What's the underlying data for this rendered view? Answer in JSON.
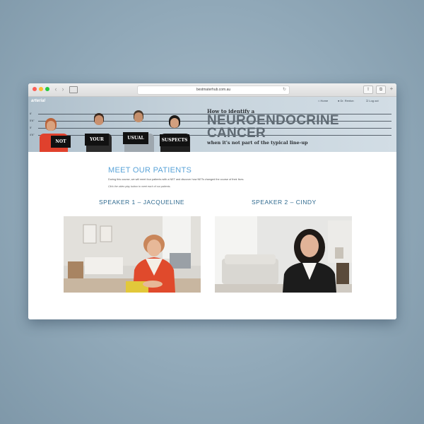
{
  "browser": {
    "url": "bestmaterhub.com.au"
  },
  "site": {
    "logo": "arterial",
    "nav": {
      "home": "Home",
      "user": "Dr. Renton",
      "logout": "Log out"
    }
  },
  "banner": {
    "height_marks": [
      "6'",
      "5'6\"",
      "5'",
      "4'6\""
    ],
    "signs": [
      "NOT",
      "YOUR",
      "USUAL",
      "SUSPECTS"
    ],
    "title_top": "How to identify a",
    "title_line1": "NEUROENDOCRINE",
    "title_line2": "CANCER",
    "title_sub": "when it's not part of the typical line-up"
  },
  "content": {
    "heading": "MEET OUR PATIENTS",
    "intro": "During this course, we will meet four patients with a NET and discover how NETs changed the course of their lives.",
    "note": "Click the video play button to meet each of our patients.",
    "speakers": [
      {
        "label": "SPEAKER 1 – JACQUELINE"
      },
      {
        "label": "SPEAKER 2 – CINDY"
      }
    ]
  }
}
